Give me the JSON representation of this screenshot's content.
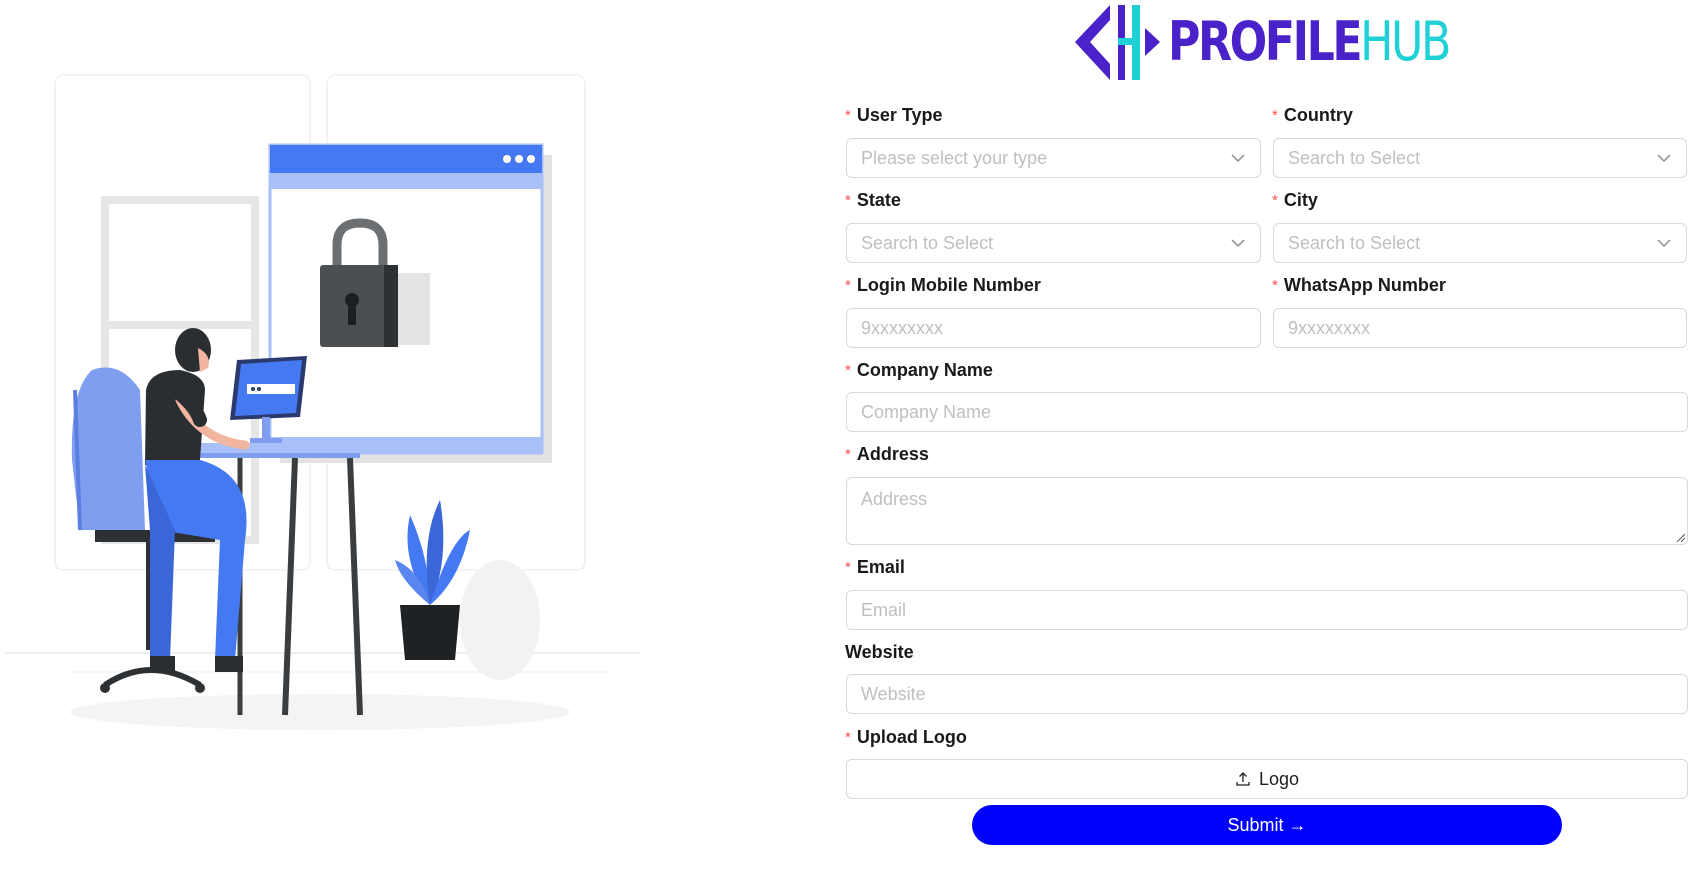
{
  "brand": {
    "part1": "PROFILE",
    "part2": "HUB",
    "colors": {
      "primary": "#4a22c9",
      "accent": "#1fd0d6"
    }
  },
  "form": {
    "user_type": {
      "label": "User Type",
      "required": "*",
      "placeholder": "Please select your type"
    },
    "country": {
      "label": "Country",
      "required": "*",
      "placeholder": "Search to Select"
    },
    "state": {
      "label": "State",
      "required": "*",
      "placeholder": "Search to Select"
    },
    "city": {
      "label": "City",
      "required": "*",
      "placeholder": "Search to Select"
    },
    "login_mobile": {
      "label": "Login Mobile Number",
      "required": "*",
      "placeholder": "9xxxxxxxx"
    },
    "whatsapp": {
      "label": "WhatsApp Number",
      "required": "*",
      "placeholder": "9xxxxxxxx"
    },
    "company_name": {
      "label": "Company Name",
      "required": "*",
      "placeholder": "Company Name"
    },
    "address": {
      "label": "Address",
      "required": "*",
      "placeholder": "Address"
    },
    "email": {
      "label": "Email",
      "required": "*",
      "placeholder": "Email"
    },
    "website": {
      "label": "Website",
      "placeholder": "Website"
    },
    "upload_logo": {
      "label": "Upload Logo",
      "required": "*",
      "button_label": "Logo"
    },
    "submit_label": "Submit →"
  },
  "icons": {
    "select_chevron": "chevron-down-icon",
    "upload": "upload-icon"
  },
  "colors": {
    "submit_bg": "#0000ff",
    "required": "#ff4d4f",
    "border": "#d9d9d9",
    "placeholder": "#bfbfbf"
  }
}
